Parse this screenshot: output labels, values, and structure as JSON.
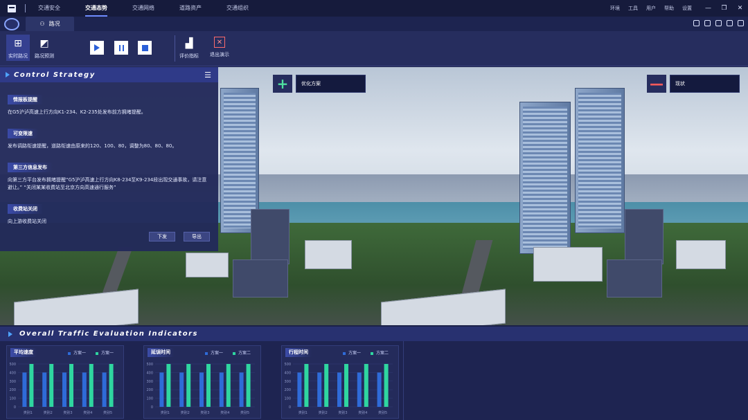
{
  "topnav": {
    "items": [
      "交通安全",
      "交通态势",
      "交通网络",
      "道路资产",
      "交通组织"
    ],
    "active_index": 1
  },
  "right_menu": [
    "环境",
    "工具",
    "用户",
    "帮助",
    "设置"
  ],
  "window_controls": [
    "—",
    "❐",
    "✕"
  ],
  "tab": {
    "label": "路况"
  },
  "toolbar": {
    "realtime_label": "实时路况",
    "forecast_label": "路况预测",
    "eval_label": "评价指标",
    "exit_label": "退出演示"
  },
  "viewport": {
    "left_overlay": {
      "button": "+",
      "label": "优化方案"
    },
    "right_overlay": {
      "button": "—",
      "label": "现状"
    }
  },
  "control_strategy": {
    "title": "Control Strategy",
    "sections": [
      {
        "heading": "情报板提醒",
        "text": "在G5沪泸高速上行方向K1-234、K2-235处发布前方拥堵提醒。"
      },
      {
        "heading": "可变限速",
        "text": "发布调路衔速提醒，道路衔速由原来的120、100、80，调整为80、80、80。"
      },
      {
        "heading": "第三方信息发布",
        "text": "向第三方平台发布拥堵提醒“G5沪泸高速上行方向K8-234至K9-234段出现交通事故，请注意避让。” “关闭某某收费站至北京方向高速通行服务”"
      },
      {
        "heading": "收费站关闭",
        "text": "向上游收费站关闭"
      }
    ],
    "send_label": "下发",
    "export_label": "导出"
  },
  "bottom": {
    "title": "Overall Traffic Evaluation Indicators"
  },
  "chart_data": [
    {
      "type": "bar",
      "title": "平均速度",
      "categories": [
        "类别1",
        "类别2",
        "类别3",
        "类别4",
        "类别5"
      ],
      "series": [
        {
          "name": "方案一",
          "values": [
            400,
            400,
            400,
            400,
            400
          ],
          "color": "#2f6bd8"
        },
        {
          "name": "方案一",
          "values": [
            500,
            500,
            500,
            500,
            500
          ],
          "color": "#2fd6a0"
        }
      ],
      "yticks": [
        0,
        100,
        200,
        300,
        400,
        500
      ],
      "ylim": [
        0,
        500
      ]
    },
    {
      "type": "bar",
      "title": "延误时间",
      "categories": [
        "类别1",
        "类别2",
        "类别3",
        "类别4",
        "类别5"
      ],
      "series": [
        {
          "name": "方案一",
          "values": [
            400,
            400,
            400,
            400,
            400
          ],
          "color": "#2f6bd8"
        },
        {
          "name": "方案二",
          "values": [
            500,
            500,
            500,
            500,
            500
          ],
          "color": "#2fd6a0"
        }
      ],
      "yticks": [
        0,
        100,
        200,
        300,
        400,
        500
      ],
      "ylim": [
        0,
        500
      ]
    },
    {
      "type": "bar",
      "title": "行程时间",
      "categories": [
        "类别1",
        "类别2",
        "类别3",
        "类别4",
        "类别5"
      ],
      "series": [
        {
          "name": "方案一",
          "values": [
            400,
            400,
            400,
            400,
            400
          ],
          "color": "#2f6bd8"
        },
        {
          "name": "方案二",
          "values": [
            500,
            500,
            500,
            500,
            500
          ],
          "color": "#2fd6a0"
        }
      ],
      "yticks": [
        0,
        100,
        200,
        300,
        400,
        500
      ],
      "ylim": [
        0,
        500
      ]
    }
  ]
}
